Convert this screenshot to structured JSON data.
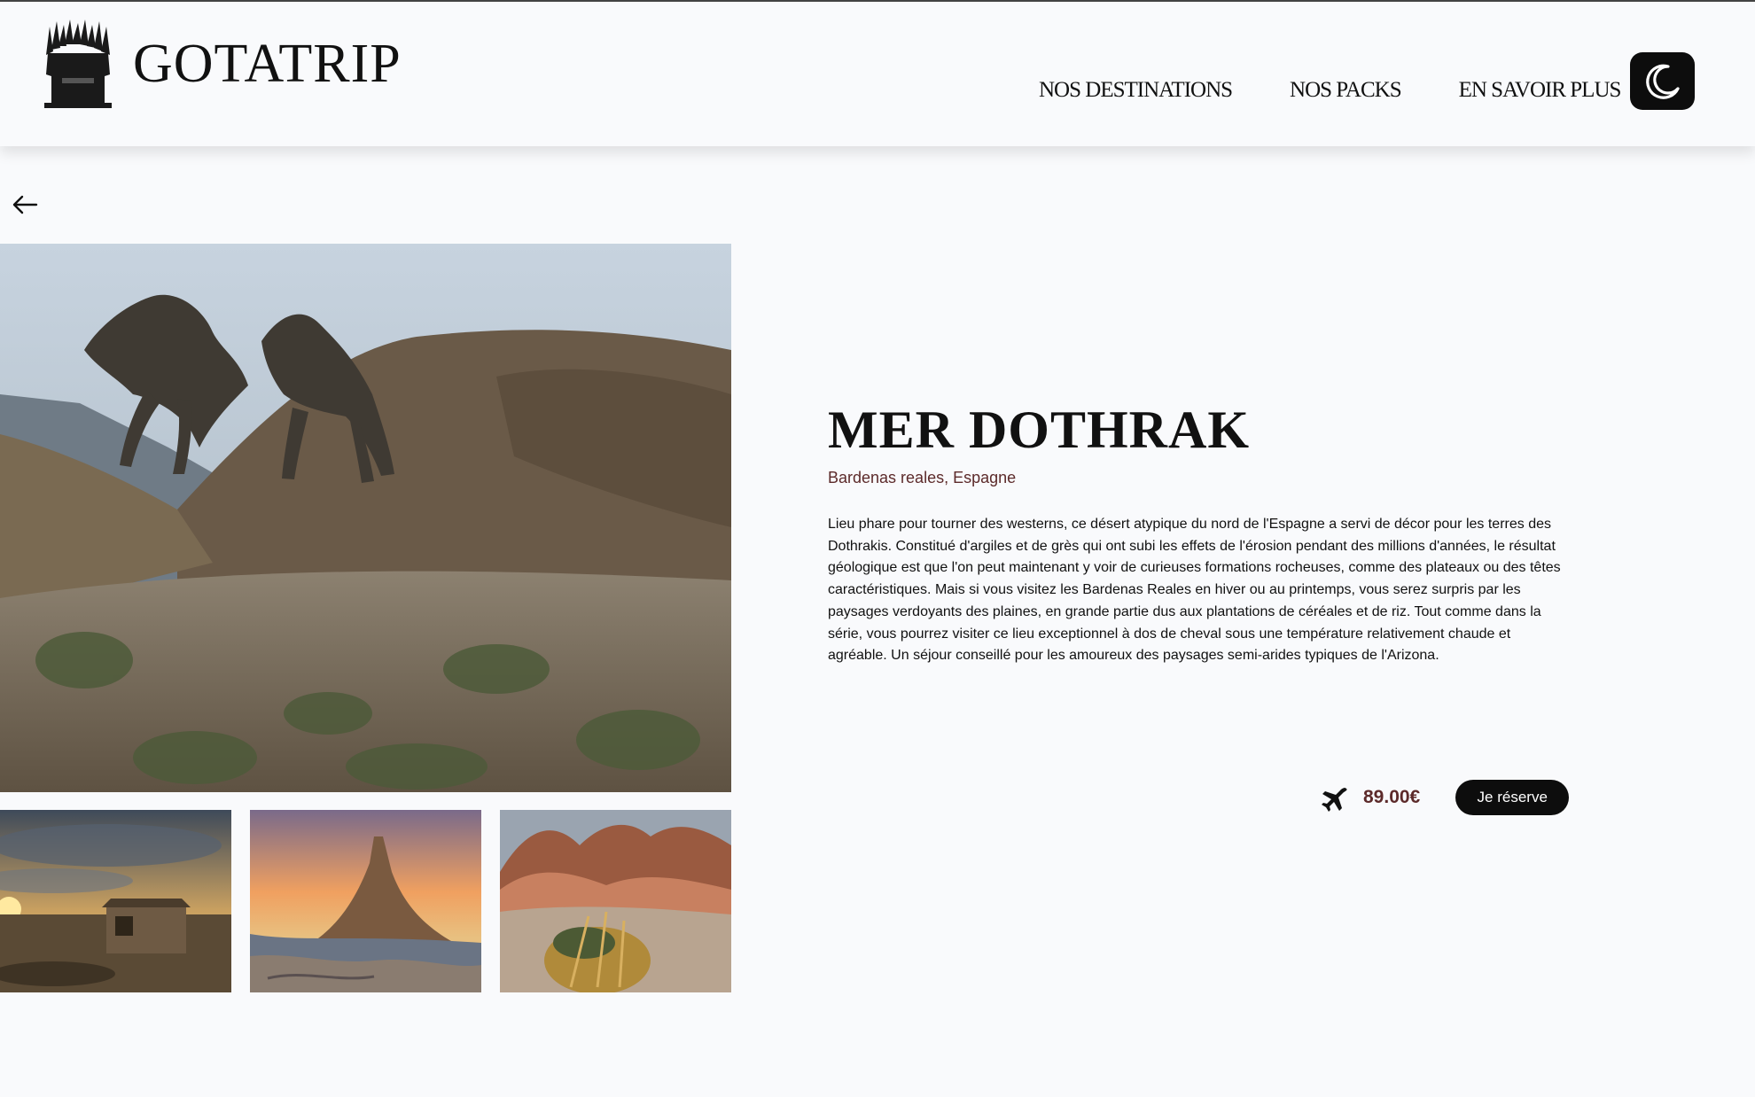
{
  "header": {
    "logo_text": "GOTATRIP",
    "nav": [
      {
        "label": "NOS DESTINATIONS"
      },
      {
        "label": "NOS PACKS"
      },
      {
        "label": "EN SAVOIR PLUS"
      }
    ],
    "theme_icon": "moon-icon"
  },
  "page": {
    "back_icon": "arrow-left-icon"
  },
  "destination": {
    "title": "MER DOTHRAK",
    "location": "Bardenas reales, Espagne",
    "description": "Lieu phare pour tourner des westerns, ce désert atypique du nord de l'Espagne a servi de décor pour les terres des Dothrakis. Constitué d'argiles et de grès qui ont subi les effets de l'érosion pendant des millions d'années, le résultat géologique est que l'on peut maintenant y voir de curieuses formations rocheuses, comme des plateaux ou des têtes caractéristiques. Mais si vous visitez les Bardenas Reales en hiver ou au printemps, vous serez surpris par les paysages verdoyants des plaines, en grande partie dus aux plantations de céréales et de riz. Tout comme dans la série, vous pourrez visiter ce lieu exceptionnel à dos de cheval sous une température relativement chaude et agréable. Un séjour conseillé pour les amoureux des paysages semi-arides typiques de l'Arizona.",
    "price": "89.00€",
    "reserve_label": "Je réserve",
    "plane_icon": "airplane-icon"
  }
}
